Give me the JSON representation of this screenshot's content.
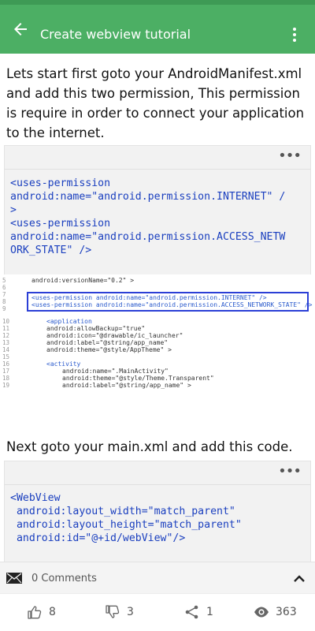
{
  "app": {
    "title": "Create webview  tutorial",
    "accent_color": "#4caf64",
    "icons": {
      "back": "arrow-left-icon",
      "menu": "more-vert-icon"
    }
  },
  "article": {
    "para1": "Lets start first goto your AndroidManifest.xml and add this two per­mission, This permission is require in order to connect your application to the internet.",
    "code1": "<uses-permission\nandroid:name=\"android.permission.INTERNET\" /\n>\n<uses-permission\nandroid:name=\"android.permission.ACCESS_NETW\nORK_STATE\" />",
    "screenshot": {
      "line_numbers": [
        "5",
        "6",
        "7",
        "8",
        "9",
        "10",
        "11",
        "12",
        "13",
        "14",
        "15",
        "16",
        "17",
        "18",
        "19"
      ],
      "lines": [
        {
          "text": "android:versionName=\"0.2\" >"
        },
        {
          "text": "<uses-permission android:name=\"android.permission.INTERNET\" />"
        },
        {
          "text": "<uses-permission android:name=\"android.permission.ACCESS_NETWORK_STATE\" />"
        },
        {
          "text": "<application"
        },
        {
          "text": "android:allowBackup=\"true\""
        },
        {
          "text": "android:icon=\"@drawable/ic_launcher\""
        },
        {
          "text": "android:label=\"@string/app_name\""
        },
        {
          "text": "android:theme=\"@style/AppTheme\" >"
        },
        {
          "text": "<activity"
        },
        {
          "text": "android:name=\".MainActivity\""
        },
        {
          "text": "android:theme=\"@style/Theme.Transparent\""
        },
        {
          "text": "android:label=\"@string/app_name\" >"
        }
      ]
    },
    "para2": "Next goto your main.xml and add this code.",
    "code2": "<WebView\n android:layout_width=\"match_parent\"\n android:layout_height=\"match_parent\"\n android:id=\"@+id/webView\"/>",
    "code_menu": "•••"
  },
  "comments": {
    "label": "0 Comments"
  },
  "actions": {
    "likes": "8",
    "dislikes": "3",
    "shares": "1",
    "views": "363"
  }
}
